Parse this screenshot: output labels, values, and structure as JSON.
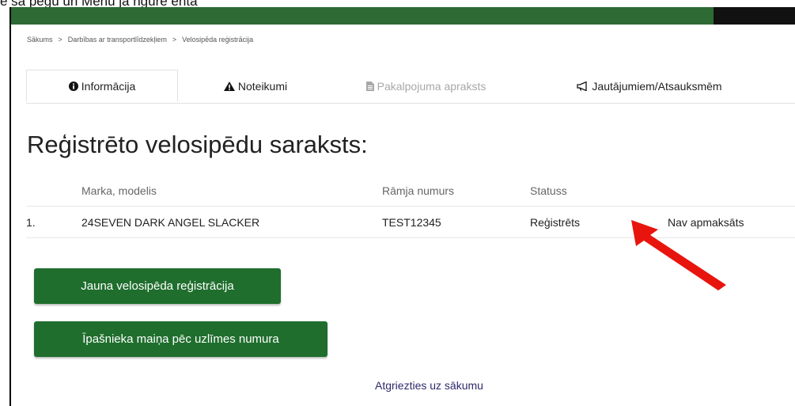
{
  "top_fragment": "e sa pegu un Menu ja ngure enta",
  "breadcrumb": [
    "Sākums",
    "Darbības ar transportlīdzekļiem",
    "Velosipēda reģistrācija"
  ],
  "breadcrumb_separator": ">",
  "tabs": [
    {
      "label": "Informācija",
      "icon": "info-circle-icon",
      "state": "active"
    },
    {
      "label": "Noteikumi",
      "icon": "warning-icon",
      "state": "normal"
    },
    {
      "label": "Pakalpojuma apraksts",
      "icon": "file-icon",
      "state": "disabled"
    },
    {
      "label": "Jautājumiem/Atsauksmēm",
      "icon": "megaphone-icon",
      "state": "normal"
    }
  ],
  "page_title": "Reģistrēto velosipēdu saraksts:",
  "table": {
    "headers": [
      "Marka, modelis",
      "Rāmja numurs",
      "Statuss"
    ],
    "rows": [
      {
        "num": "1.",
        "model": "24SEVEN DARK ANGEL SLACKER",
        "frame": "TEST12345",
        "status": "Reģistrēts",
        "payment": "Nav apmaksāts"
      }
    ]
  },
  "buttons": {
    "new_registration": "Jauna velosipēda reģistrācija",
    "owner_change": "Īpašnieka maiņa pēc uzlīmes numura"
  },
  "back_link": "Atgriezties uz sākumu",
  "colors": {
    "header_green": "#2e6a33",
    "button_green": "#1f6e2d",
    "link": "#2d2a6b",
    "arrow_red": "#e8150e"
  }
}
